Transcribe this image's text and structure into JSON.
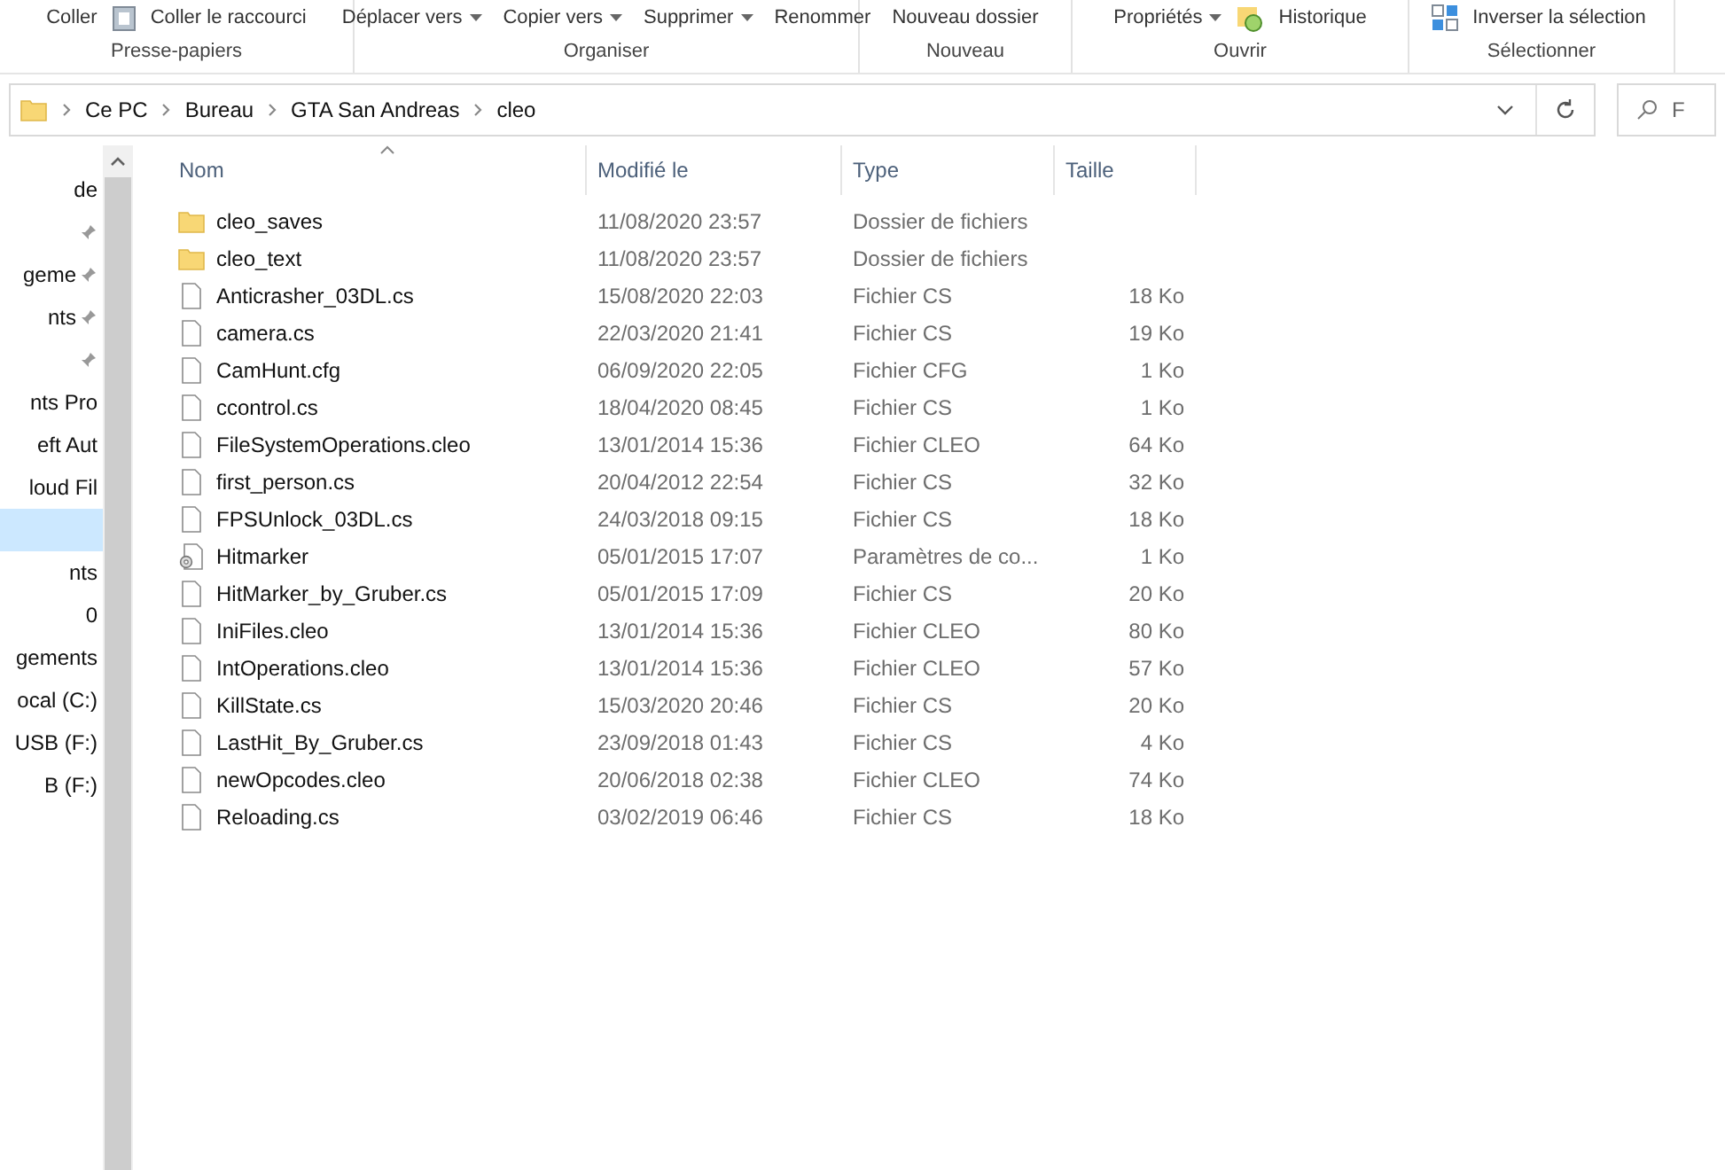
{
  "ribbon": {
    "groups": [
      {
        "label": "Presse-papiers",
        "items": [
          {
            "kind": "plain",
            "text": "Coller"
          },
          {
            "kind": "paste-shortcut",
            "text": "Coller le raccourci"
          }
        ]
      },
      {
        "label": "Organiser",
        "items": [
          {
            "kind": "dropdown",
            "text": "Déplacer vers"
          },
          {
            "kind": "dropdown",
            "text": "Copier vers"
          },
          {
            "kind": "dropdown",
            "text": "Supprimer"
          },
          {
            "kind": "plain",
            "text": "Renommer"
          }
        ]
      },
      {
        "label": "Nouveau",
        "items": [
          {
            "kind": "plain",
            "text": "Nouveau dossier"
          }
        ]
      },
      {
        "label": "Ouvrir",
        "items": [
          {
            "kind": "dropdown",
            "text": "Propriétés"
          },
          {
            "kind": "history",
            "text": "Historique"
          }
        ]
      },
      {
        "label": "Sélectionner",
        "items": [
          {
            "kind": "invert",
            "text": "Inverser la sélection"
          }
        ]
      }
    ]
  },
  "address_bar": {
    "path": [
      "Ce PC",
      "Bureau",
      "GTA San Andreas",
      "cleo"
    ]
  },
  "search": {
    "placeholder": "F"
  },
  "sidebar": {
    "items": [
      {
        "label": "de",
        "pinned": false,
        "selected": false
      },
      {
        "pinned": true,
        "selected": false
      },
      {
        "label": "geme",
        "pinned": true,
        "selected": false
      },
      {
        "label": "nts",
        "pinned": true,
        "selected": false
      },
      {
        "pinned": true,
        "selected": false
      },
      {
        "label": "nts Pro",
        "pinned": false,
        "selected": false
      },
      {
        "label": "eft Aut",
        "pinned": false,
        "selected": false
      },
      {
        "label": "loud Fil",
        "pinned": false,
        "selected": false
      },
      {
        "pinned": false,
        "selected": true
      },
      {
        "label": "nts",
        "pinned": false,
        "selected": false
      },
      {
        "label": "0",
        "pinned": false,
        "selected": false
      },
      {
        "label": "gements",
        "pinned": false,
        "selected": false
      },
      {
        "label": "ocal (C:)",
        "pinned": false,
        "selected": false
      },
      {
        "label": "USB (F:)",
        "pinned": false,
        "selected": false
      },
      {
        "label": "B (F:)",
        "pinned": false,
        "selected": false
      }
    ]
  },
  "table": {
    "columns": [
      "Nom",
      "Modifié le",
      "Type",
      "Taille"
    ],
    "rows": [
      {
        "kind": "folder",
        "name": "cleo_saves",
        "modified": "11/08/2020 23:57",
        "type": "Dossier de fichiers",
        "size": ""
      },
      {
        "kind": "folder",
        "name": "cleo_text",
        "modified": "11/08/2020 23:57",
        "type": "Dossier de fichiers",
        "size": ""
      },
      {
        "kind": "file",
        "name": "Anticrasher_03DL.cs",
        "modified": "15/08/2020 22:03",
        "type": "Fichier CS",
        "size": "18 Ko"
      },
      {
        "kind": "file",
        "name": "camera.cs",
        "modified": "22/03/2020 21:41",
        "type": "Fichier CS",
        "size": "19 Ko"
      },
      {
        "kind": "file",
        "name": "CamHunt.cfg",
        "modified": "06/09/2020 22:05",
        "type": "Fichier CFG",
        "size": "1 Ko"
      },
      {
        "kind": "file",
        "name": "ccontrol.cs",
        "modified": "18/04/2020 08:45",
        "type": "Fichier CS",
        "size": "1 Ko"
      },
      {
        "kind": "file",
        "name": "FileSystemOperations.cleo",
        "modified": "13/01/2014 15:36",
        "type": "Fichier CLEO",
        "size": "64 Ko"
      },
      {
        "kind": "file",
        "name": "first_person.cs",
        "modified": "20/04/2012 22:54",
        "type": "Fichier CS",
        "size": "32 Ko"
      },
      {
        "kind": "file",
        "name": "FPSUnlock_03DL.cs",
        "modified": "24/03/2018 09:15",
        "type": "Fichier CS",
        "size": "18 Ko"
      },
      {
        "kind": "settings",
        "name": "Hitmarker",
        "modified": "05/01/2015 17:07",
        "type": "Paramètres de co...",
        "size": "1 Ko"
      },
      {
        "kind": "file",
        "name": "HitMarker_by_Gruber.cs",
        "modified": "05/01/2015 17:09",
        "type": "Fichier CS",
        "size": "20 Ko"
      },
      {
        "kind": "file",
        "name": "IniFiles.cleo",
        "modified": "13/01/2014 15:36",
        "type": "Fichier CLEO",
        "size": "80 Ko"
      },
      {
        "kind": "file",
        "name": "IntOperations.cleo",
        "modified": "13/01/2014 15:36",
        "type": "Fichier CLEO",
        "size": "57 Ko"
      },
      {
        "kind": "file",
        "name": "KillState.cs",
        "modified": "15/03/2020 20:46",
        "type": "Fichier CS",
        "size": "20 Ko"
      },
      {
        "kind": "file",
        "name": "LastHit_By_Gruber.cs",
        "modified": "23/09/2018 01:43",
        "type": "Fichier CS",
        "size": "4 Ko"
      },
      {
        "kind": "file",
        "name": "newOpcodes.cleo",
        "modified": "20/06/2018 02:38",
        "type": "Fichier CLEO",
        "size": "74 Ko"
      },
      {
        "kind": "file",
        "name": "Reloading.cs",
        "modified": "03/02/2019 06:46",
        "type": "Fichier CS",
        "size": "18 Ko"
      }
    ]
  }
}
